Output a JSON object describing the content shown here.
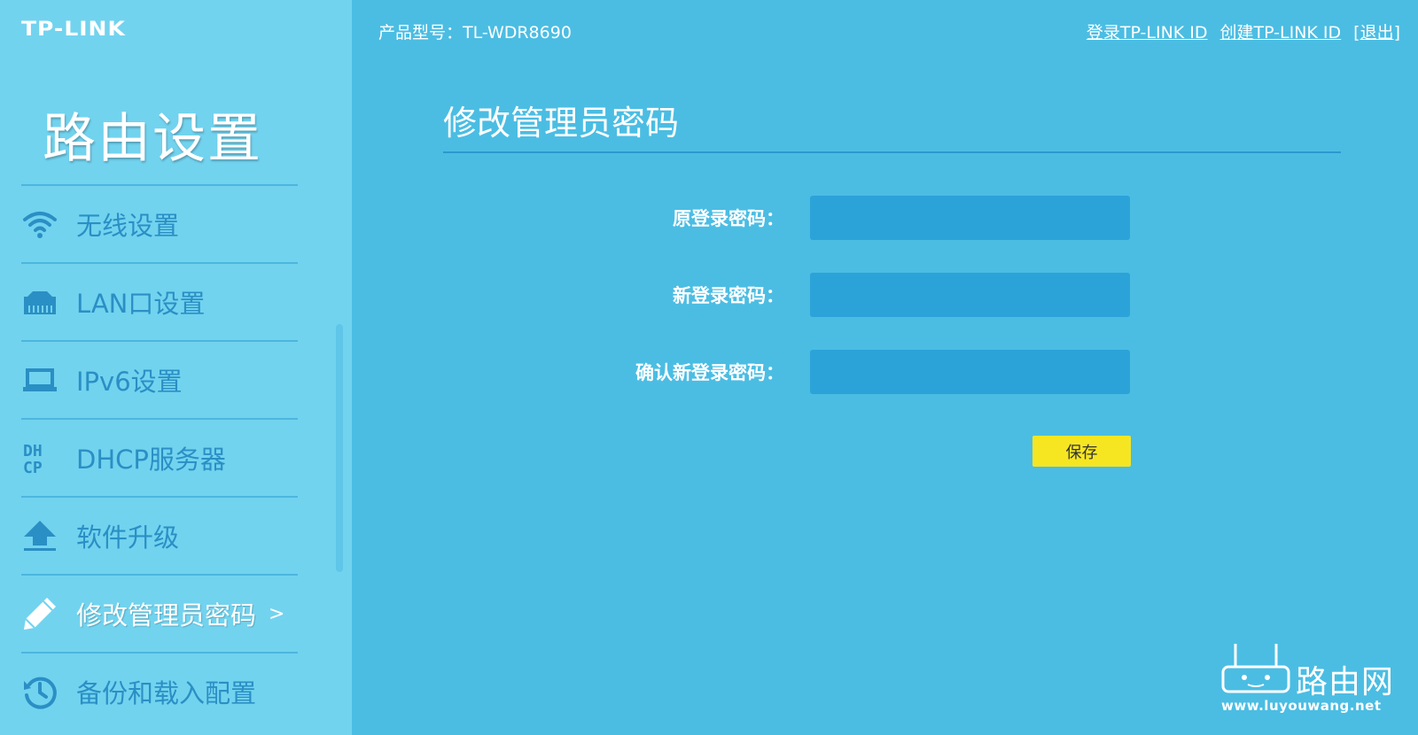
{
  "brand": {
    "logo_text": "TP-LINK"
  },
  "header": {
    "model_label": "产品型号：TL-WDR8690",
    "links": [
      "登录TP-LINK ID",
      "创建TP-LINK ID",
      "[退出]"
    ]
  },
  "sidebar": {
    "title": "路由设置",
    "items": [
      {
        "label": "无线设置",
        "icon": "wifi-icon"
      },
      {
        "label": "LAN口设置",
        "icon": "lan-port-icon"
      },
      {
        "label": "IPv6设置",
        "icon": "laptop-icon"
      },
      {
        "label": "DHCP服务器",
        "icon": "dhcp-icon"
      },
      {
        "label": "软件升级",
        "icon": "upload-icon"
      },
      {
        "label": "修改管理员密码",
        "icon": "pencil-icon",
        "active": true,
        "arrow": ">"
      },
      {
        "label": "备份和载入配置",
        "icon": "history-icon"
      }
    ]
  },
  "main": {
    "title": "修改管理员密码",
    "fields": [
      {
        "label": "原登录密码：",
        "value": ""
      },
      {
        "label": "新登录密码：",
        "value": ""
      },
      {
        "label": "确认新登录密码：",
        "value": ""
      }
    ],
    "save_label": "保存"
  },
  "watermark": {
    "brand": "路由网",
    "url": "www.luyouwang.net"
  },
  "colors": {
    "sidebar_bg": "#72d3ef",
    "main_bg": "#4bbde3",
    "input_bg": "#2ba3d8",
    "save_button": "#f6e622",
    "nav_text": "#2a8fc4"
  }
}
